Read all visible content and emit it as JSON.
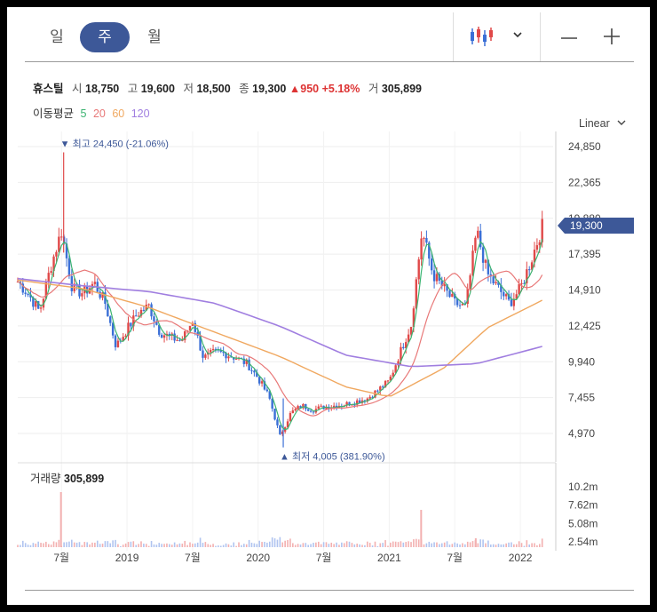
{
  "tabs": [
    "일",
    "주",
    "월"
  ],
  "active_tab": "주",
  "toolbar": {
    "chart_type_icon": "candlestick-icon",
    "dropdown_icon": "chevron-down-icon",
    "zoom_out_icon": "minus-icon",
    "zoom_in_icon": "plus-icon"
  },
  "quote": {
    "name": "휴스틸",
    "open_label": "시",
    "open": "18,750",
    "high_label": "고",
    "high": "19,600",
    "low_label": "저",
    "low": "18,500",
    "close_label": "종",
    "close": "19,300",
    "change_arrow": "▲",
    "change": "950",
    "change_pct": "+5.18%",
    "volume_label": "거",
    "volume": "305,899"
  },
  "moving_average": {
    "label": "이동평균",
    "periods": [
      "5",
      "20",
      "60",
      "120"
    ]
  },
  "scale_selector": "Linear",
  "current_price_tag": "19,300",
  "volume_panel": {
    "label": "거래량",
    "value": "305,899"
  },
  "colors": {
    "up": "#e04848",
    "down": "#3a6fd6",
    "ma5": "#3cb371",
    "ma20": "#e87878",
    "ma60": "#f0a860",
    "ma120": "#a07ee0",
    "accent": "#3d5898"
  },
  "chart_data": {
    "type": "candlestick",
    "yticks": [
      "24,850",
      "22,365",
      "19,880",
      "17,395",
      "14,910",
      "12,425",
      "9,940",
      "7,455",
      "4,970"
    ],
    "ylim": [
      4000,
      25500
    ],
    "xticks": [
      "7월",
      "2019",
      "7월",
      "2020",
      "7월",
      "2021",
      "7월",
      "2022"
    ],
    "x_range": [
      "2018-03",
      "2022-04"
    ],
    "annotations": [
      {
        "text": "최고",
        "value": "24,450 (-21.06%)",
        "marker": "▼"
      },
      {
        "text": "최저",
        "value": "4,005 (381.90%)",
        "marker": "▲"
      }
    ],
    "volume_yticks": [
      "10.2m",
      "7.62m",
      "5.08m",
      "2.54m"
    ],
    "close_trace": [
      [
        "2018-03",
        15500
      ],
      [
        "2018-04",
        14600
      ],
      [
        "2018-05",
        13400
      ],
      [
        "2018-06",
        16500
      ],
      [
        "2018-07",
        19000
      ],
      [
        "2018-08",
        15000
      ],
      [
        "2018-09",
        14700
      ],
      [
        "2018-10",
        15400
      ],
      [
        "2018-11",
        14000
      ],
      [
        "2018-12",
        11000
      ],
      [
        "2019-01",
        12200
      ],
      [
        "2019-02",
        13300
      ],
      [
        "2019-03",
        13800
      ],
      [
        "2019-04",
        12000
      ],
      [
        "2019-05",
        11600
      ],
      [
        "2019-06",
        11400
      ],
      [
        "2019-07",
        12800
      ],
      [
        "2019-08",
        10200
      ],
      [
        "2019-09",
        10600
      ],
      [
        "2019-10",
        10500
      ],
      [
        "2019-11",
        10200
      ],
      [
        "2019-12",
        9800
      ],
      [
        "2020-01",
        8800
      ],
      [
        "2020-02",
        7500
      ],
      [
        "2020-03",
        4800
      ],
      [
        "2020-04",
        6400
      ],
      [
        "2020-05",
        6900
      ],
      [
        "2020-06",
        6600
      ],
      [
        "2020-07",
        6800
      ],
      [
        "2020-08",
        6900
      ],
      [
        "2020-09",
        7000
      ],
      [
        "2020-10",
        7200
      ],
      [
        "2020-11",
        7400
      ],
      [
        "2020-12",
        8000
      ],
      [
        "2021-01",
        8600
      ],
      [
        "2021-02",
        10600
      ],
      [
        "2021-03",
        12500
      ],
      [
        "2021-04",
        19000
      ],
      [
        "2021-05",
        16000
      ],
      [
        "2021-06",
        15000
      ],
      [
        "2021-07",
        14000
      ],
      [
        "2021-08",
        13700
      ],
      [
        "2021-09",
        19000
      ],
      [
        "2021-10",
        16000
      ],
      [
        "2021-11",
        15000
      ],
      [
        "2021-12",
        14000
      ],
      [
        "2022-01",
        15000
      ],
      [
        "2022-02",
        17000
      ],
      [
        "2022-03",
        19300
      ]
    ],
    "ma120_trace": [
      [
        "2018-03",
        15700
      ],
      [
        "2018-09",
        15200
      ],
      [
        "2019-03",
        14800
      ],
      [
        "2019-09",
        14000
      ],
      [
        "2020-03",
        12400
      ],
      [
        "2020-09",
        10400
      ],
      [
        "2021-03",
        9600
      ],
      [
        "2021-09",
        9800
      ],
      [
        "2022-03",
        11000
      ]
    ],
    "ma60_trace": [
      [
        "2018-03",
        15600
      ],
      [
        "2018-09",
        15000
      ],
      [
        "2019-03",
        13700
      ],
      [
        "2019-09",
        12000
      ],
      [
        "2020-03",
        10300
      ],
      [
        "2020-09",
        8200
      ],
      [
        "2021-01",
        7500
      ],
      [
        "2021-06",
        9500
      ],
      [
        "2021-10",
        12300
      ],
      [
        "2022-03",
        14200
      ]
    ]
  }
}
